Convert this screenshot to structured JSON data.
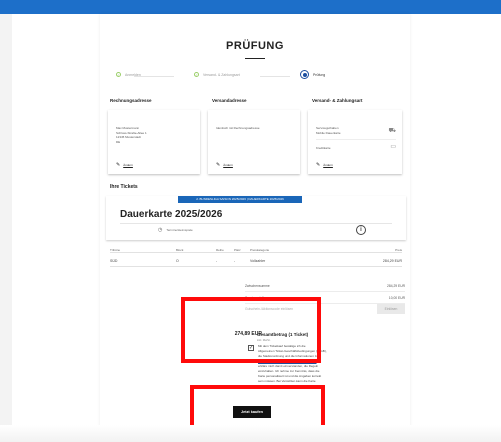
{
  "page": {
    "title": "PRÜFUNG"
  },
  "steps": [
    {
      "label": "Anmelden",
      "done": true
    },
    {
      "label": "Versand- & Zahlungsart",
      "done": true
    },
    {
      "label": "Prüfung",
      "active": true
    }
  ],
  "sections": {
    "billing": {
      "heading": "Rechnungsadresse",
      "lines": [
        "Max Mustermann",
        "Schloss-Straße-Allee 1",
        "12345 Musterstadt",
        "DE"
      ],
      "edit_label": "Ändern"
    },
    "shipping": {
      "heading": "Versandadresse",
      "lines": [
        "Identisch mit Rechnungsadresse"
      ],
      "edit_label": "Ändern"
    },
    "payment": {
      "heading": "Versand- & Zahlungsart",
      "shipping_lines": [
        "Serviceguthaben",
        "Mobile Dauerkarte"
      ],
      "payment_line": "Kreditkarte",
      "edit_label": "Ändern"
    }
  },
  "tickets": {
    "heading": "Ihre Tickets",
    "league_tag": "2. BUNDESLIGA SAISON 2025/2026 | DAUERKARTE 2025/2026",
    "name": "Dauerkarte 2025/2026",
    "sub": "Termine/Heimspiele",
    "columns": [
      "Tribüne",
      "Block",
      "Reihe",
      "Platz",
      "Preiskategorie",
      "Preis"
    ],
    "rows": [
      {
        "tribune": "SÜD",
        "block": "O",
        "row": "-",
        "seat": "-",
        "category": "Vollzahler",
        "price": "284,29 EUR"
      }
    ]
  },
  "totals": {
    "rows": [
      {
        "label": "Zwischensumme",
        "value": "284,29 EUR"
      },
      {
        "label": "Servicegebühren",
        "value": "10,00 EUR"
      }
    ],
    "code_label": "Gutschein-/Aktionscode einlösen",
    "code_button": "Einlösen",
    "grand_label": "Gesamtbetrag (1 Ticket)",
    "grand_sub": "inkl. MwSt.",
    "grand_value": "274,89 EUR"
  },
  "agreement": {
    "checked": true,
    "lines": [
      "Mit dem Ticketkauf bestätige ich die",
      "Allgemeinen Ticket-Geschäftsbedingungen (ATGB),",
      "die Stadionordnung und die Informationen zum",
      "Datenschutz (Website/Online-Ticketing) und",
      "erkläre mich damit einverstanden, die Regeln",
      "einzuhalten. Ich nehme zur Kenntnis, dass die",
      "Karte personalisiert ist und die Angaben korrekt",
      "sein müssen. Bei Verstößen kann die Karte",
      "eingezogen werden."
    ]
  },
  "actions": {
    "pay_label": "Jetzt kaufen"
  },
  "colors": {
    "brand": "#1d6fc9",
    "annotation": "#ff0a0a"
  }
}
